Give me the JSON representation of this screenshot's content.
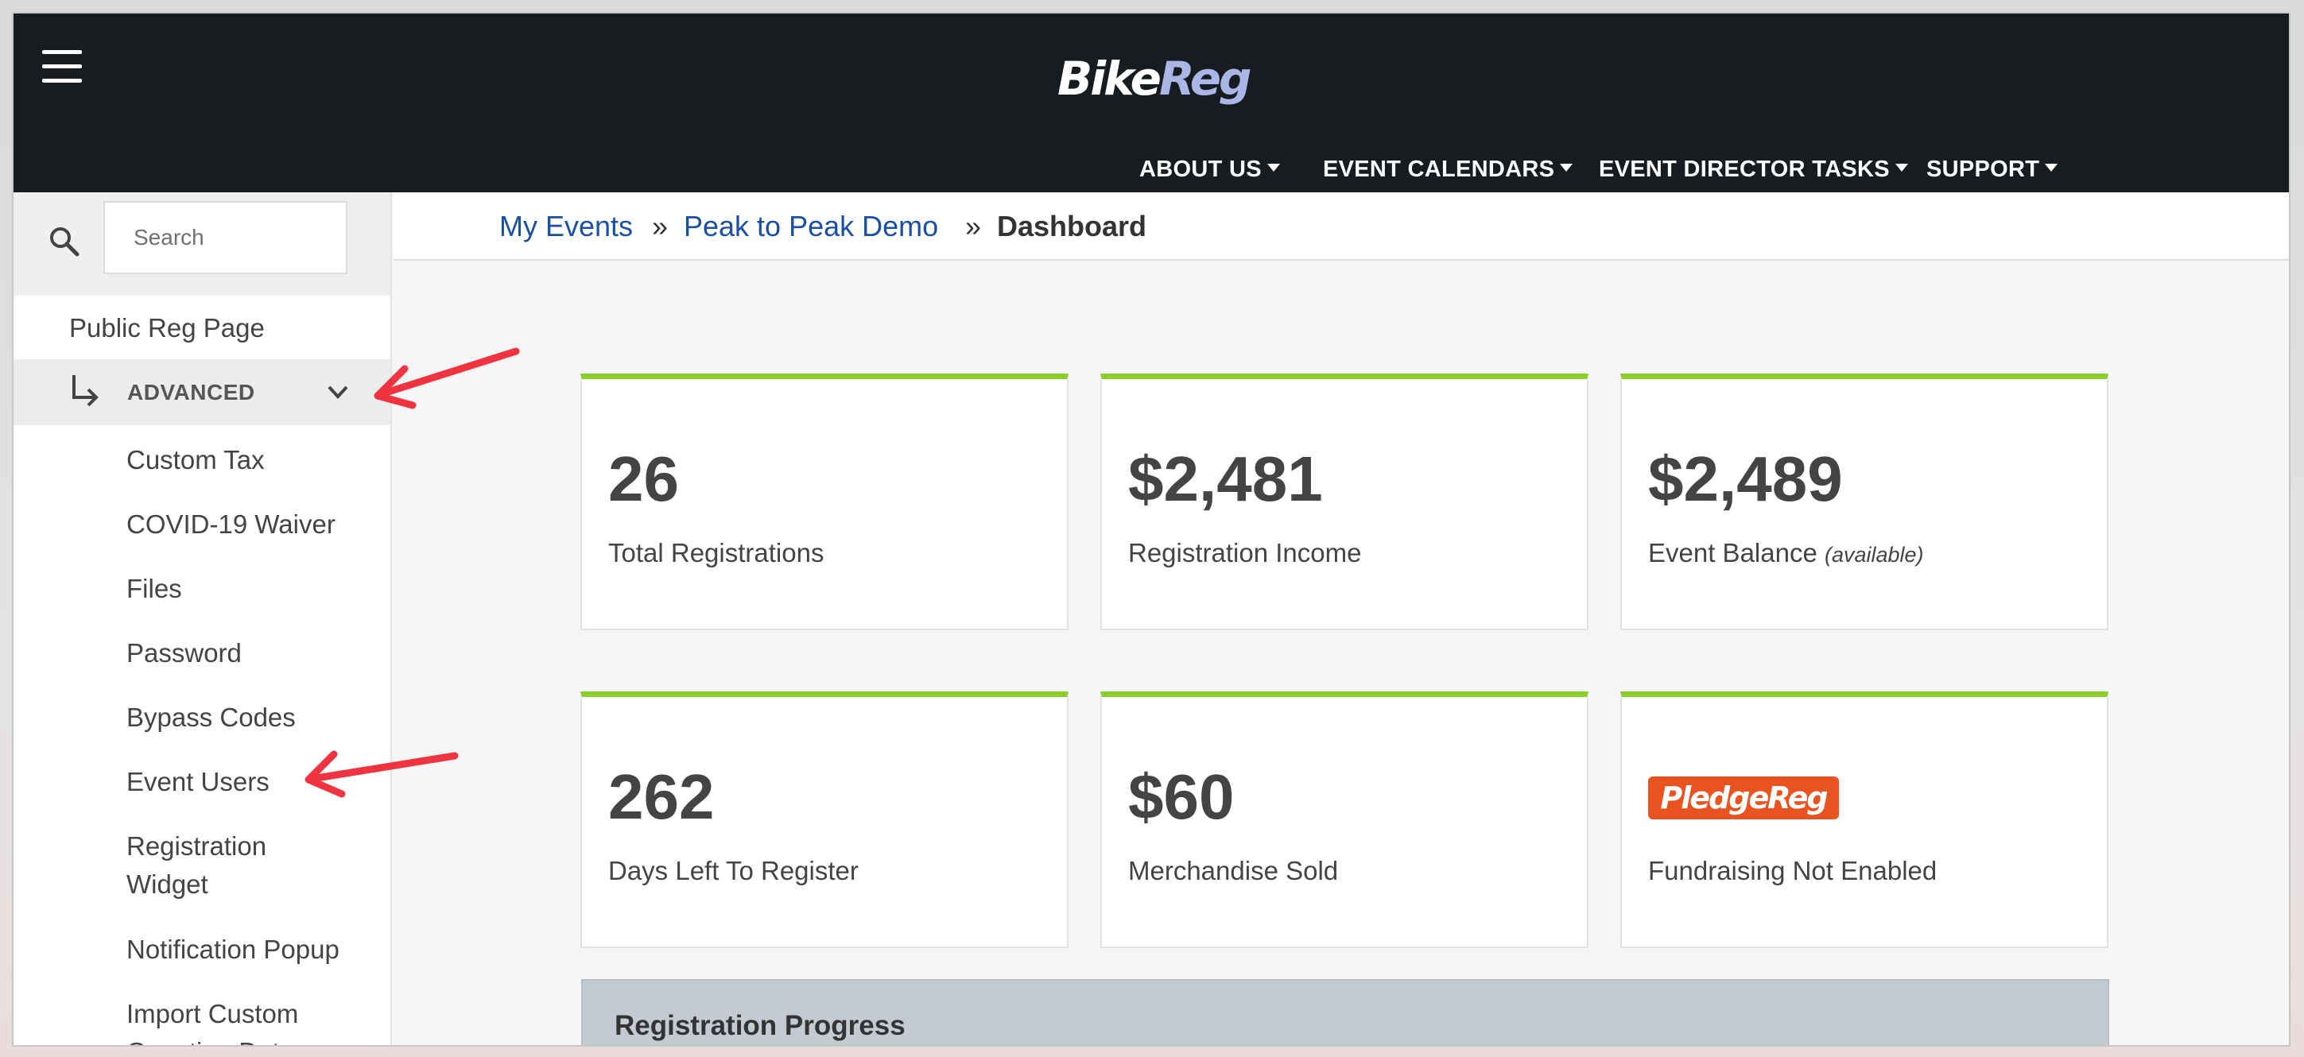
{
  "header": {
    "logo_part1": "Bike",
    "logo_part2": "Reg",
    "nav": [
      {
        "label": "ABOUT US"
      },
      {
        "label": "EVENT CALENDARS"
      },
      {
        "label": "EVENT DIRECTOR TASKS"
      },
      {
        "label": "SUPPORT"
      }
    ]
  },
  "sidebar": {
    "search_placeholder": "Search",
    "public_reg_page": "Public Reg Page",
    "advanced_label": "ADVANCED",
    "items": [
      "Custom Tax",
      "COVID-19 Waiver",
      "Files",
      "Password",
      "Bypass Codes",
      "Event Users",
      "Registration",
      "Widget",
      "Notification Popup",
      "Import Custom",
      "Question Data"
    ]
  },
  "breadcrumb": {
    "items": [
      "My Events",
      "Peak to Peak Demo"
    ],
    "separator": "»",
    "current": "Dashboard"
  },
  "stats": [
    {
      "value": "26",
      "label": "Total Registrations"
    },
    {
      "value": "$2,481",
      "label": "Registration Income"
    },
    {
      "value": "$2,489",
      "label": "Event Balance",
      "note": "(available)"
    },
    {
      "value": "262",
      "label": "Days Left To Register"
    },
    {
      "value": "$60",
      "label": "Merchandise Sold"
    },
    {
      "logo": "PledgeReg",
      "label": "Fundraising Not Enabled"
    }
  ],
  "progress": {
    "title": "Registration Progress"
  },
  "colors": {
    "header_bg": "#161c20",
    "accent_green": "#8ccd2a",
    "link_blue": "#1a4fa6",
    "annotation_red": "#ef3340",
    "pledge_orange": "#e8531f"
  }
}
